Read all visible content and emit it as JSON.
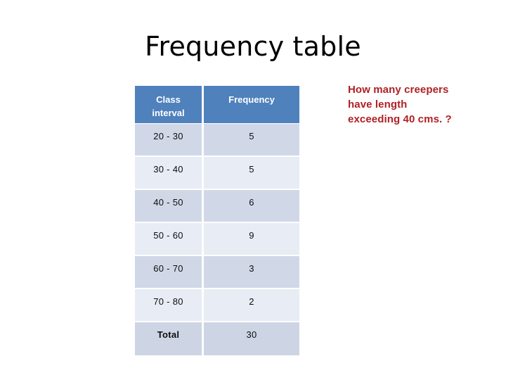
{
  "slide": {
    "title": "Frequency table",
    "background_color": "#FFFFFF"
  },
  "table": {
    "name": "frequency-table",
    "header_color": "#4F81BD",
    "row_color_dark": "#D0D8E8",
    "row_color_light": "#E8ECF4",
    "columns": [
      {
        "key": "interval",
        "label_line1": "Class",
        "label_line2": "interval"
      },
      {
        "key": "frequency",
        "label_line1": "Frequency",
        "label_line2": ""
      }
    ],
    "rows": [
      {
        "interval": "20 - 30",
        "frequency": "5"
      },
      {
        "interval": "30 - 40",
        "frequency": "5"
      },
      {
        "interval": "40 - 50",
        "frequency": "6"
      },
      {
        "interval": "50 - 60",
        "frequency": "9"
      },
      {
        "interval": "60 - 70",
        "frequency": "3"
      },
      {
        "interval": "70 - 80",
        "frequency": "2"
      }
    ],
    "total_row": {
      "interval": "Total",
      "frequency": "30"
    }
  },
  "question": {
    "color": "#B02024",
    "line1": "How many creepers",
    "line2": "have length",
    "line3": "exceeding 40 cms. ?"
  }
}
